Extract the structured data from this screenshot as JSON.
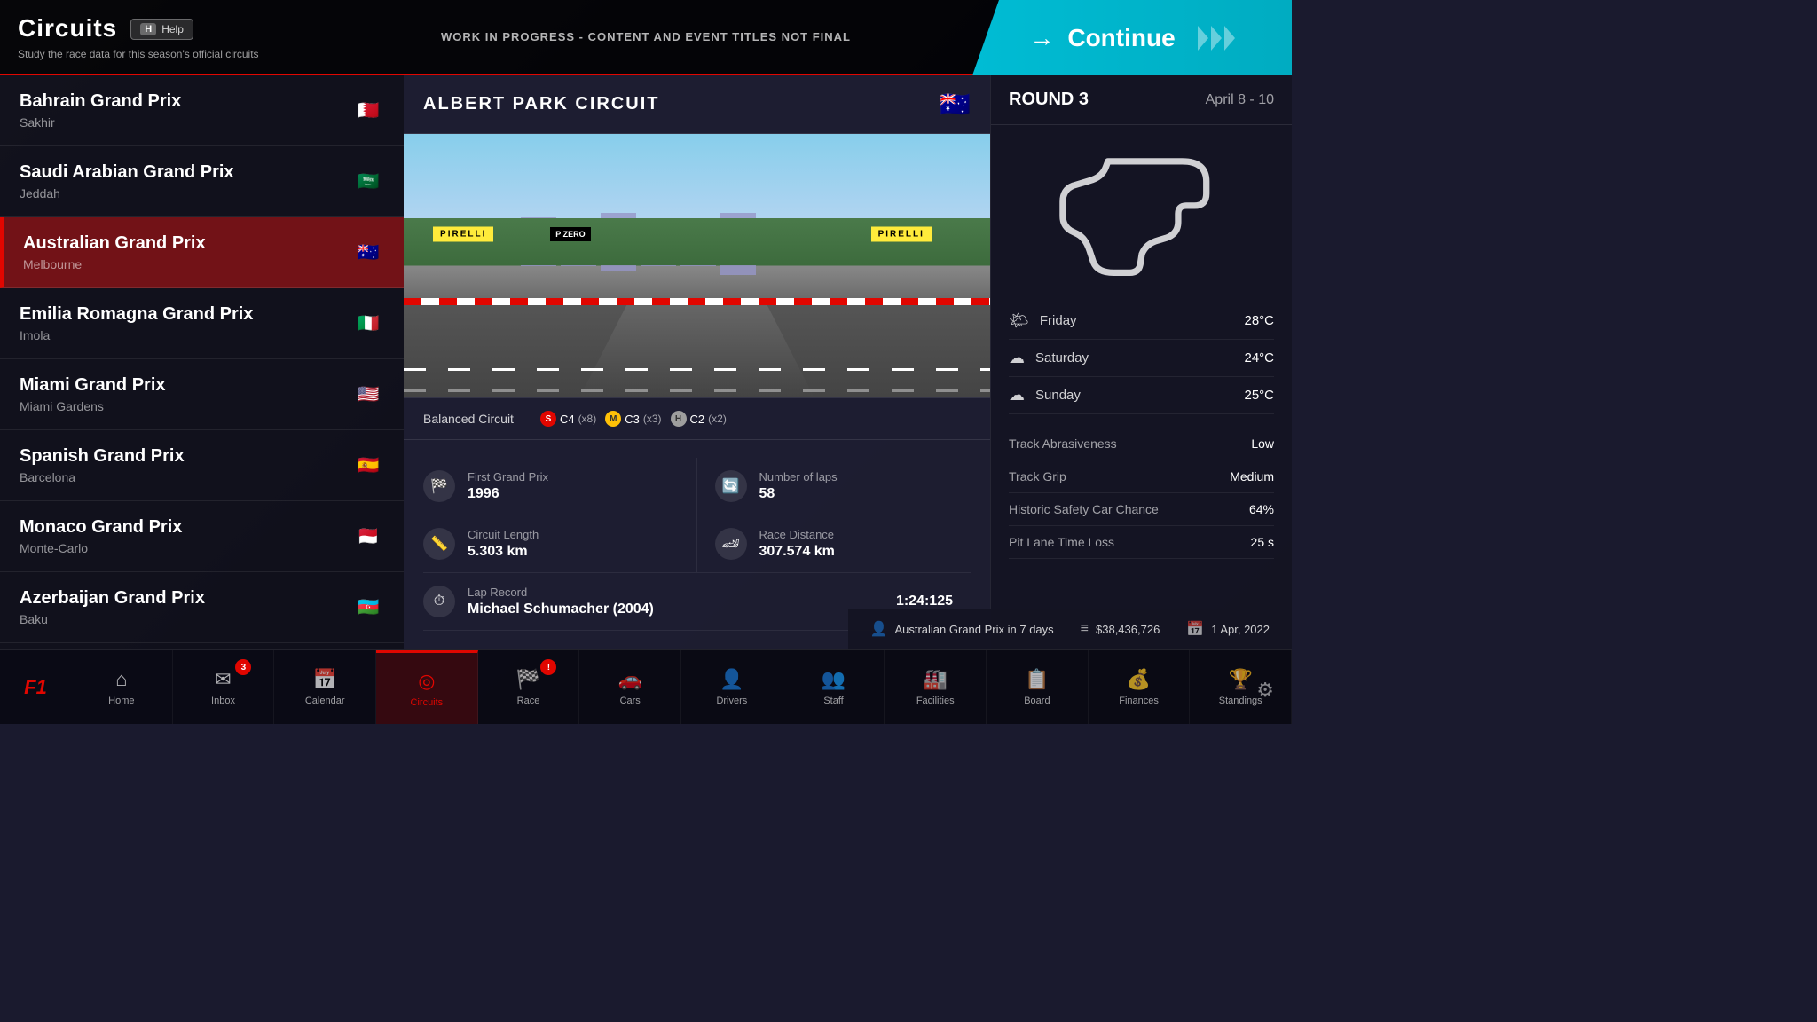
{
  "header": {
    "title": "Circuits",
    "subtitle": "Study the race data for this season's official circuits",
    "help_label": "Help",
    "help_key": "H",
    "wip_notice": "WORK IN PROGRESS - CONTENT AND EVENT TITLES NOT FINAL",
    "continue_label": "Continue"
  },
  "circuit_list": {
    "items": [
      {
        "id": "bahrain",
        "name": "Bahrain Grand Prix",
        "city": "Sakhir",
        "flag": "🇧🇭",
        "active": false
      },
      {
        "id": "saudi",
        "name": "Saudi Arabian Grand Prix",
        "city": "Jeddah",
        "flag": "🇸🇦",
        "active": false
      },
      {
        "id": "australia",
        "name": "Australian Grand Prix",
        "city": "Melbourne",
        "flag": "🇦🇺",
        "active": true
      },
      {
        "id": "emilia",
        "name": "Emilia Romagna Grand Prix",
        "city": "Imola",
        "flag": "🇮🇹",
        "active": false
      },
      {
        "id": "miami",
        "name": "Miami Grand Prix",
        "city": "Miami Gardens",
        "flag": "🇺🇸",
        "active": false
      },
      {
        "id": "spanish",
        "name": "Spanish Grand Prix",
        "city": "Barcelona",
        "flag": "🇪🇸",
        "active": false
      },
      {
        "id": "monaco",
        "name": "Monaco Grand Prix",
        "city": "Monte-Carlo",
        "flag": "🇲🇨",
        "active": false
      },
      {
        "id": "azerbaijan",
        "name": "Azerbaijan Grand Prix",
        "city": "Baku",
        "flag": "🇦🇿",
        "active": false
      }
    ]
  },
  "circuit_detail": {
    "circuit_name": "ALBERT PARK CIRCUIT",
    "flag": "🇦🇺",
    "circuit_type": "Balanced Circuit",
    "tire_compounds": [
      {
        "type": "S",
        "label": "C4",
        "count": "x8",
        "color": "#e10600"
      },
      {
        "type": "M",
        "label": "C3",
        "count": "x3",
        "color": "#ffc107"
      },
      {
        "type": "H",
        "label": "C2",
        "count": "x2",
        "color": "#9e9e9e"
      }
    ],
    "stats": [
      {
        "icon": "🏁",
        "label": "First Grand Prix",
        "value": "1996"
      },
      {
        "icon": "🔄",
        "label": "Number of laps",
        "value": "58"
      },
      {
        "icon": "📏",
        "label": "Circuit Length",
        "value": "5.303 km"
      },
      {
        "icon": "🏎",
        "label": "Race Distance",
        "value": "307.574 km"
      },
      {
        "icon": "⏱",
        "label": "Lap Record",
        "value": "1:24:125",
        "sub": "Michael Schumacher (2004)"
      }
    ],
    "lap_record_holder": "Michael Schumacher (2004)",
    "lap_record_time": "1:24:125"
  },
  "round_info": {
    "label": "ROUND 3",
    "dates": "April 8 - 10",
    "weather": [
      {
        "day": "Friday",
        "icon": "🌤",
        "temp": "28°C"
      },
      {
        "day": "Saturday",
        "icon": "☁",
        "temp": "24°C"
      },
      {
        "day": "Sunday",
        "icon": "☁",
        "temp": "25°C"
      }
    ],
    "track_props": [
      {
        "label": "Track Abrasiveness",
        "value": "Low"
      },
      {
        "label": "Track Grip",
        "value": "Medium"
      },
      {
        "label": "Historic Safety Car Chance",
        "value": "64%"
      },
      {
        "label": "Pit Lane Time Loss",
        "value": "25 s"
      }
    ]
  },
  "status_bar": {
    "next_race": "Australian Grand Prix in 7 days",
    "budget": "$38,436,726",
    "date": "1 Apr, 2022"
  },
  "bottom_nav": {
    "items": [
      {
        "id": "home",
        "label": "Home",
        "icon": "⌂",
        "active": false,
        "badge": null
      },
      {
        "id": "inbox",
        "label": "Inbox",
        "icon": "✉",
        "active": false,
        "badge": "3"
      },
      {
        "id": "calendar",
        "label": "Calendar",
        "icon": "📅",
        "active": false,
        "badge": null
      },
      {
        "id": "circuits",
        "label": "Circuits",
        "icon": "◎",
        "active": true,
        "badge": null
      },
      {
        "id": "race",
        "label": "Race",
        "icon": "🏁",
        "active": false,
        "badge": "!"
      },
      {
        "id": "cars",
        "label": "Cars",
        "icon": "🚗",
        "active": false,
        "badge": null
      },
      {
        "id": "drivers",
        "label": "Drivers",
        "icon": "👤",
        "active": false,
        "badge": null
      },
      {
        "id": "staff",
        "label": "Staff",
        "icon": "👥",
        "active": false,
        "badge": null
      },
      {
        "id": "facilities",
        "label": "Facilities",
        "icon": "🏭",
        "active": false,
        "badge": null
      },
      {
        "id": "board",
        "label": "Board",
        "icon": "📋",
        "active": false,
        "badge": null
      },
      {
        "id": "finances",
        "label": "Finances",
        "icon": "💰",
        "active": false,
        "badge": null
      },
      {
        "id": "standings",
        "label": "Standings",
        "icon": "🏆",
        "active": false,
        "badge": null
      }
    ]
  }
}
